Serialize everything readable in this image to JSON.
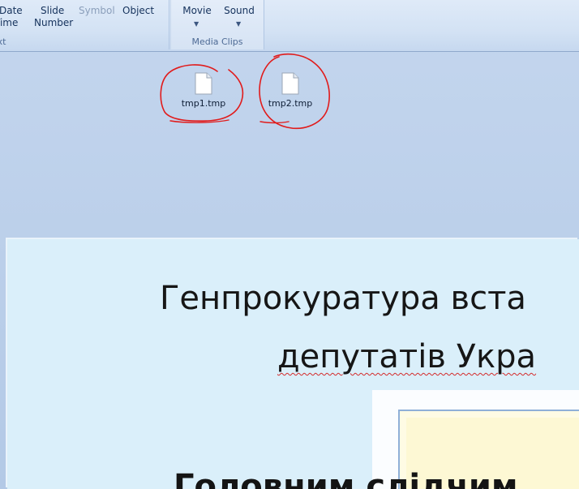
{
  "ribbon": {
    "text_group": {
      "date_time_line1": "Date",
      "date_time_line2": "Time",
      "slide_number_line1": "Slide",
      "slide_number_line2": "Number",
      "symbol_label": "Symbol",
      "object_label": "Object",
      "group_label": "ext"
    },
    "media_group": {
      "movie_label": "Movie",
      "sound_label": "Sound",
      "group_label": "Media Clips"
    }
  },
  "desktop": {
    "files": [
      {
        "name": "tmp1.tmp",
        "icon": "file-icon",
        "annotated": true
      },
      {
        "name": "tmp2.tmp",
        "icon": "file-icon",
        "annotated": true
      }
    ],
    "annotation_color": "#e11b1b"
  },
  "slide": {
    "title_line_1": "Генпрокуратура вста",
    "title_line_2": "депутатів Укра",
    "body_text": "Головним  слідчим",
    "background_color": "#daeffa"
  }
}
